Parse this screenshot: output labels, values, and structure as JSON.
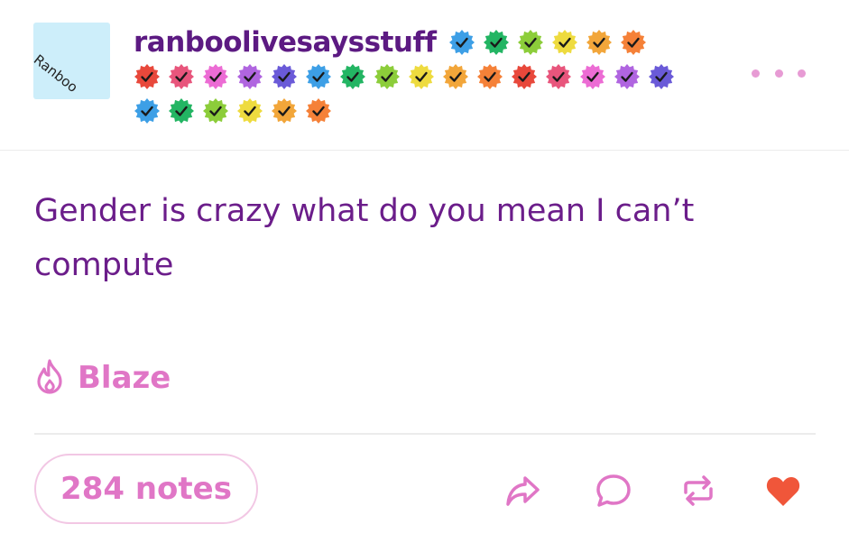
{
  "post": {
    "avatar": {
      "text": "Ranboo",
      "background": "#cdeefa",
      "icon": "avatar"
    },
    "username": "ranboolivesaysstuff",
    "badge_icon": "verified-check-badge-icon",
    "badges": {
      "row1": [
        "#3d9fe6",
        "#23b563",
        "#8ccd3a",
        "#eedb3f",
        "#f2a63a",
        "#f58138"
      ],
      "row2": [
        "#e8483b",
        "#e8557c",
        "#ec6cd4",
        "#b065e0",
        "#6a5ad8",
        "#3d9fe6",
        "#23b563",
        "#8ccd3a",
        "#eedb3f",
        "#f2a63a",
        "#f58138",
        "#e8483b",
        "#e8557c",
        "#ec6cd4",
        "#b065e0",
        "#6a5ad8"
      ],
      "row3": [
        "#3d9fe6",
        "#23b563",
        "#8ccd3a",
        "#eedb3f",
        "#f2a63a",
        "#f58138"
      ]
    },
    "more_icon": "ellipsis-icon",
    "body_text": "Gender is crazy what do you mean I can’t compute",
    "blaze": {
      "label": "Blaze",
      "icon": "flame-icon"
    },
    "notes_label": "284 notes",
    "actions": {
      "share_icon": "share-arrow-icon",
      "reply_icon": "reply-bubble-icon",
      "reblog_icon": "reblog-icon",
      "like_icon": "heart-icon"
    },
    "colors": {
      "username": "#5c1a82",
      "body_text": "#6b1d8a",
      "accent_pink": "#e076c6",
      "pill_border": "#f2c7e4",
      "heart": "#f0563a"
    }
  }
}
